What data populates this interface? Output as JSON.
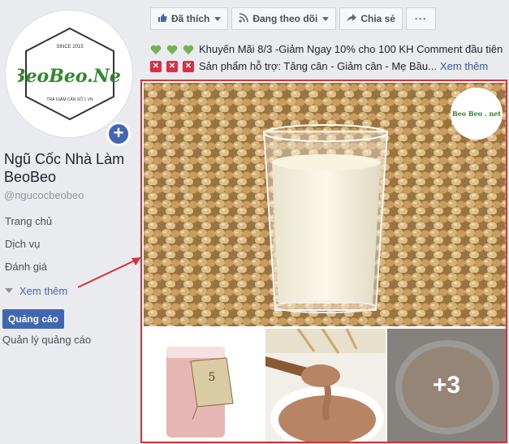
{
  "page": {
    "name": "Ngũ Cốc Nhà Làm BeoBeo",
    "handle": "@ngucocbeobeo"
  },
  "logo": {
    "brand": "BeoBeo.Net",
    "since": "SINCE 2015",
    "slogan": "TRÀ GIẢM CÂN SỐ 1 VN",
    "mini_brand": "Beo Beo . net"
  },
  "nav": {
    "items": [
      "Trang chủ",
      "Dịch vụ",
      "Đánh giá"
    ],
    "more": "Xem thêm"
  },
  "ads": {
    "button": "Quảng cáo",
    "manage": "Quản lý quảng cáo"
  },
  "actions": {
    "like": "Đã thích",
    "follow": "Đang theo dõi",
    "share": "Chia sẻ",
    "more": "···"
  },
  "post": {
    "line1": "Khuyến Mãi 8/3 -Giảm Ngay 10% cho 100 KH Comment đầu tiên",
    "line2": "Sản phẩm hỗ trợ: Tăng cân - Giảm cân - Mẹ Bầu...",
    "see_more": "Xem thêm"
  },
  "gallery": {
    "extra_count": "+3"
  },
  "colors": {
    "fb_blue": "#4267b2",
    "highlight_red": "#d9313a",
    "brand_green": "#2c8a2c",
    "heart_green": "#77b255",
    "x_red": "#dd2e44"
  }
}
